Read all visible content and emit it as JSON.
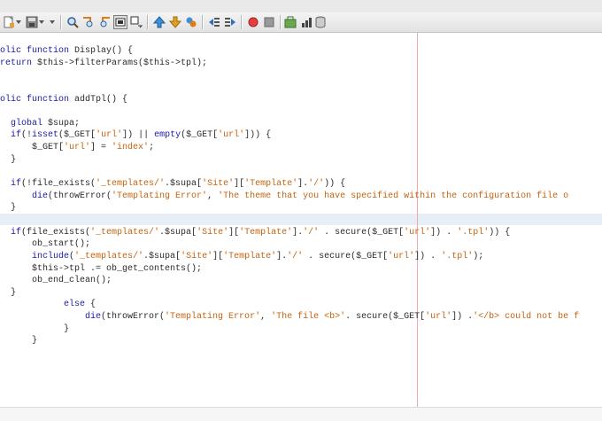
{
  "toolbar": {
    "buttons": [
      "new-file-icon",
      "dropdown-arrow-icon",
      "save-icon",
      "dropdown-arrow-icon",
      "find-icon",
      "find-previous-icon",
      "find-next-icon",
      "toggle-highlight-icon",
      "replace-icon",
      "previous-bookmark-icon",
      "next-bookmark-icon",
      "toggle-bookmark-icon",
      "shift-left-icon",
      "shift-right-icon",
      "record-macro-icon",
      "stop-macro-icon",
      "run-icon",
      "chart-icon",
      "database-icon"
    ],
    "colors": {
      "record": "#e34040",
      "stop": "#888888",
      "accent": "#2f6fbf"
    }
  },
  "editor": {
    "lines": [
      [
        {
          "t": "kw",
          "v": "olic function"
        },
        {
          "t": "fn",
          "v": " Display() {"
        }
      ],
      [
        {
          "t": "kw",
          "v": "return"
        },
        {
          "t": "var",
          "v": " $this->filterParams($this->tpl);"
        }
      ],
      [
        {
          "t": "fn",
          "v": ""
        }
      ],
      [
        {
          "t": "fn",
          "v": ""
        }
      ],
      [
        {
          "t": "kw",
          "v": "olic function"
        },
        {
          "t": "fn",
          "v": " addTpl() {"
        }
      ],
      [
        {
          "t": "fn",
          "v": ""
        }
      ],
      [
        {
          "t": "kw",
          "v": "  global"
        },
        {
          "t": "var",
          "v": " $supa;"
        }
      ],
      [
        {
          "t": "kw",
          "v": "  if"
        },
        {
          "t": "fn",
          "v": "(!"
        },
        {
          "t": "kw",
          "v": "isset"
        },
        {
          "t": "fn",
          "v": "($_GET["
        },
        {
          "t": "str",
          "v": "'url'"
        },
        {
          "t": "fn",
          "v": "]) || "
        },
        {
          "t": "kw",
          "v": "empty"
        },
        {
          "t": "fn",
          "v": "($_GET["
        },
        {
          "t": "str",
          "v": "'url'"
        },
        {
          "t": "fn",
          "v": "])) {"
        }
      ],
      [
        {
          "t": "fn",
          "v": "      $_GET["
        },
        {
          "t": "str",
          "v": "'url'"
        },
        {
          "t": "fn",
          "v": "] = "
        },
        {
          "t": "str",
          "v": "'index'"
        },
        {
          "t": "fn",
          "v": ";"
        }
      ],
      [
        {
          "t": "fn",
          "v": "  }"
        }
      ],
      [
        {
          "t": "fn",
          "v": ""
        }
      ],
      [
        {
          "t": "kw",
          "v": "  if"
        },
        {
          "t": "fn",
          "v": "(!file_exists("
        },
        {
          "t": "str",
          "v": "'_templates/'"
        },
        {
          "t": "fn",
          "v": ".$supa["
        },
        {
          "t": "str",
          "v": "'Site'"
        },
        {
          "t": "fn",
          "v": "]["
        },
        {
          "t": "str",
          "v": "'Template'"
        },
        {
          "t": "fn",
          "v": "]."
        },
        {
          "t": "str",
          "v": "'/'"
        },
        {
          "t": "fn",
          "v": ")) {"
        }
      ],
      [
        {
          "t": "kw",
          "v": "      die"
        },
        {
          "t": "fn",
          "v": "(throwError("
        },
        {
          "t": "str",
          "v": "'Templating Error'"
        },
        {
          "t": "fn",
          "v": ", "
        },
        {
          "t": "str",
          "v": "'The theme that you have specified within the configuration file o"
        }
      ],
      [
        {
          "t": "fn",
          "v": "  }"
        }
      ],
      [
        {
          "t": "fn",
          "v": ""
        }
      ],
      [
        {
          "t": "kw",
          "v": "  if"
        },
        {
          "t": "fn",
          "v": "(file_exists("
        },
        {
          "t": "str",
          "v": "'_templates/'"
        },
        {
          "t": "fn",
          "v": ".$supa["
        },
        {
          "t": "str",
          "v": "'Site'"
        },
        {
          "t": "fn",
          "v": "]["
        },
        {
          "t": "str",
          "v": "'Template'"
        },
        {
          "t": "fn",
          "v": "]."
        },
        {
          "t": "str",
          "v": "'/'"
        },
        {
          "t": "fn",
          "v": " . secure($_GET["
        },
        {
          "t": "str",
          "v": "'url'"
        },
        {
          "t": "fn",
          "v": "]) . "
        },
        {
          "t": "str",
          "v": "'.tpl'"
        },
        {
          "t": "fn",
          "v": ")) {"
        }
      ],
      [
        {
          "t": "fn",
          "v": "      ob_start();"
        }
      ],
      [
        {
          "t": "kw",
          "v": "      include"
        },
        {
          "t": "fn",
          "v": "("
        },
        {
          "t": "str",
          "v": "'_templates/'"
        },
        {
          "t": "fn",
          "v": ".$supa["
        },
        {
          "t": "str",
          "v": "'Site'"
        },
        {
          "t": "fn",
          "v": "]["
        },
        {
          "t": "str",
          "v": "'Template'"
        },
        {
          "t": "fn",
          "v": "]."
        },
        {
          "t": "str",
          "v": "'/'"
        },
        {
          "t": "fn",
          "v": " . secure($_GET["
        },
        {
          "t": "str",
          "v": "'url'"
        },
        {
          "t": "fn",
          "v": "]) . "
        },
        {
          "t": "str",
          "v": "'.tpl'"
        },
        {
          "t": "fn",
          "v": ");"
        }
      ],
      [
        {
          "t": "fn",
          "v": "      $this->tpl .= ob_get_contents();"
        }
      ],
      [
        {
          "t": "fn",
          "v": "      ob_end_clean();"
        }
      ],
      [
        {
          "t": "fn",
          "v": "  }"
        }
      ],
      [
        {
          "t": "kw",
          "v": "            else"
        },
        {
          "t": "fn",
          "v": " {"
        }
      ],
      [
        {
          "t": "kw",
          "v": "                die"
        },
        {
          "t": "fn",
          "v": "(throwError("
        },
        {
          "t": "str",
          "v": "'Templating Error'"
        },
        {
          "t": "fn",
          "v": ", "
        },
        {
          "t": "str",
          "v": "'The file <b>'"
        },
        {
          "t": "fn",
          "v": ". secure($_GET["
        },
        {
          "t": "str",
          "v": "'url'"
        },
        {
          "t": "fn",
          "v": "]) ."
        },
        {
          "t": "str",
          "v": "'</b> could not be f"
        }
      ],
      [
        {
          "t": "fn",
          "v": "            }"
        }
      ],
      [
        {
          "t": "fn",
          "v": "      }"
        }
      ]
    ]
  }
}
